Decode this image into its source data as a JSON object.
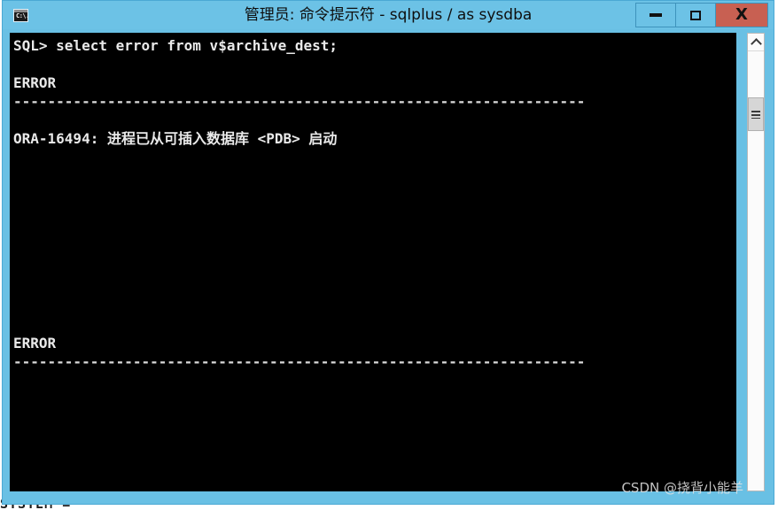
{
  "window": {
    "title": "管理员: 命令提示符 - sqlplus  / as sysdba",
    "icon_name": "cmd-console-icon",
    "icon_glyph": "C:\\.",
    "colors": {
      "title_bar": "#6cc2e6",
      "frame": "#69c0e4",
      "close_button": "#c86052",
      "console_background": "#000000",
      "console_foreground": "#e9e9e9"
    },
    "controls": {
      "minimize_label": "—",
      "maximize_label": "□",
      "close_label": "X"
    }
  },
  "console": {
    "lines": [
      {
        "text": "SQL> select error from v$archive_dest;",
        "style": "normal"
      },
      {
        "text": "",
        "style": "blank"
      },
      {
        "text": "ERROR",
        "style": "normal"
      },
      {
        "text": "-------------------------------------------------------------------",
        "style": "dash"
      },
      {
        "text": "",
        "style": "blank"
      },
      {
        "text": "ORA-16494: 进程已从可插入数据库 <PDB> 启动",
        "style": "cjk"
      },
      {
        "text": "",
        "style": "blank"
      },
      {
        "text": "",
        "style": "blank"
      },
      {
        "text": "",
        "style": "blank"
      },
      {
        "text": "",
        "style": "blank"
      },
      {
        "text": "",
        "style": "blank"
      },
      {
        "text": "",
        "style": "blank"
      },
      {
        "text": "",
        "style": "blank"
      },
      {
        "text": "",
        "style": "blank"
      },
      {
        "text": "",
        "style": "blank"
      },
      {
        "text": "",
        "style": "blank"
      },
      {
        "text": "ERROR",
        "style": "normal"
      },
      {
        "text": "-------------------------------------------------------------------",
        "style": "dash"
      },
      {
        "text": "",
        "style": "blank"
      },
      {
        "text": "",
        "style": "blank"
      },
      {
        "text": "",
        "style": "blank"
      },
      {
        "text": "",
        "style": "blank"
      },
      {
        "text": "",
        "style": "blank"
      },
      {
        "text": "",
        "style": "blank"
      },
      {
        "text": "",
        "style": "blank"
      }
    ]
  },
  "scrollbar": {
    "up_arrow_name": "scroll-up-arrow",
    "thumb_name": "scroll-thumb"
  },
  "watermark": {
    "text": "CSDN @挠背小能羊"
  },
  "underlay": {
    "text": "SYSTEM ="
  }
}
